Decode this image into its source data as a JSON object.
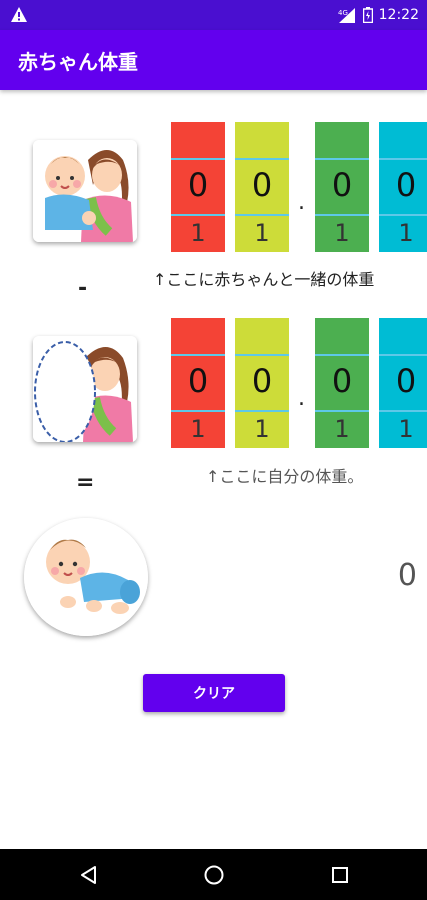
{
  "status_bar": {
    "time": "12:22",
    "signal_label": "4G"
  },
  "app_bar": {
    "title": "赤ちゃん体重"
  },
  "with_baby": {
    "digits": [
      {
        "value": "0",
        "next": "1",
        "color": "#f44336"
      },
      {
        "value": "0",
        "next": "1",
        "color": "#cddc39"
      },
      {
        "value": "0",
        "next": "1",
        "color": "#4caf50"
      },
      {
        "value": "0",
        "next": "1",
        "color": "#00bcd4"
      }
    ],
    "decimal": ".",
    "hint": "↑ここに赤ちゃんと一緒の体重"
  },
  "operator_minus": "-",
  "self_only": {
    "digits": [
      {
        "value": "0",
        "next": "1",
        "color": "#f44336"
      },
      {
        "value": "0",
        "next": "1",
        "color": "#cddc39"
      },
      {
        "value": "0",
        "next": "1",
        "color": "#4caf50"
      },
      {
        "value": "0",
        "next": "1",
        "color": "#00bcd4"
      }
    ],
    "decimal": ".",
    "hint": "↑ここに自分の体重。"
  },
  "operator_equals": "=",
  "result": {
    "value": "0"
  },
  "clear_button": {
    "label": "クリア"
  },
  "colors": {
    "accent": "#6200ee",
    "status_bar": "#4a0fd0"
  }
}
